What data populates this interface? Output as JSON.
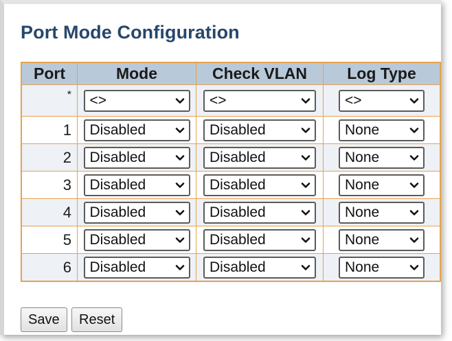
{
  "page": {
    "title": "Port Mode Configuration"
  },
  "table": {
    "headers": [
      "Port",
      "Mode",
      "Check VLAN",
      "Log Type"
    ],
    "rows": [
      {
        "port": "*",
        "mode": "<>",
        "check_vlan": "<>",
        "log_type": "<>"
      },
      {
        "port": "1",
        "mode": "Disabled",
        "check_vlan": "Disabled",
        "log_type": "None"
      },
      {
        "port": "2",
        "mode": "Disabled",
        "check_vlan": "Disabled",
        "log_type": "None"
      },
      {
        "port": "3",
        "mode": "Disabled",
        "check_vlan": "Disabled",
        "log_type": "None"
      },
      {
        "port": "4",
        "mode": "Disabled",
        "check_vlan": "Disabled",
        "log_type": "None"
      },
      {
        "port": "5",
        "mode": "Disabled",
        "check_vlan": "Disabled",
        "log_type": "None"
      },
      {
        "port": "6",
        "mode": "Disabled",
        "check_vlan": "Disabled",
        "log_type": "None"
      }
    ]
  },
  "buttons": {
    "save_label": "Save",
    "reset_label": "Reset"
  },
  "icons": {
    "dropdown": "chevron-down-icon"
  },
  "colors": {
    "title": "#27476b",
    "header_bg": "#b8c9da",
    "table_border": "#e5a24f",
    "row_alt_bg": "#eef1f6"
  }
}
